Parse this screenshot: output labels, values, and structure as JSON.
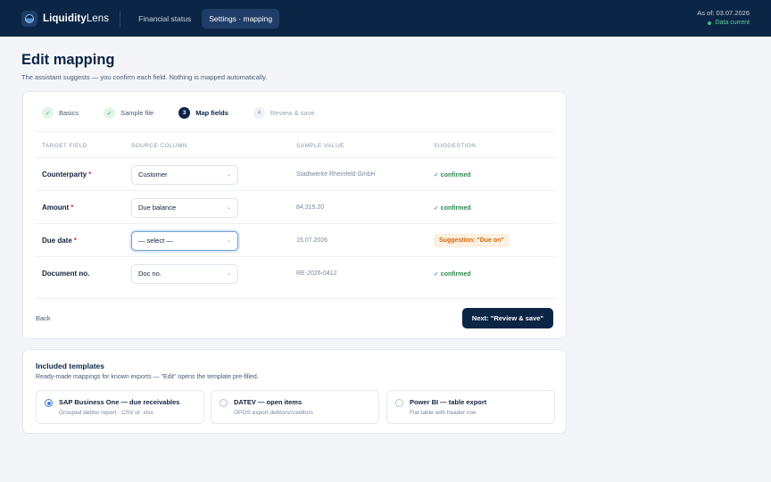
{
  "app": {
    "name_bold": "Liquidity",
    "name_rest": "Lens"
  },
  "nav": [
    {
      "label": "Financial status"
    },
    {
      "label": "Settings · mapping"
    }
  ],
  "status": {
    "as_of": "As of: 03.07.2026",
    "data_state": "Data current",
    "ok_color": "#3fbf7f"
  },
  "page": {
    "title": "Edit mapping",
    "subtitle": "The assistant suggests — you confirm each field. Nothing is mapped automatically."
  },
  "steps": [
    {
      "badge": "✓",
      "label": "Basics",
      "state": "done"
    },
    {
      "badge": "✓",
      "label": "Sample file",
      "state": "done"
    },
    {
      "badge": "3",
      "label": "Map fields",
      "state": "current"
    },
    {
      "badge": "4",
      "label": "Review & save",
      "state": "todo"
    }
  ],
  "table": {
    "headers": {
      "target": "TARGET FIELD",
      "source": "SOURCE COLUMN",
      "sample": "SAMPLE VALUE",
      "suggestion": "SUGGESTION"
    },
    "rows": [
      {
        "field": "Counterparty",
        "required": "*",
        "source": "Customer",
        "sample": "Stadtwerke Rheinfeld GmbH",
        "suggestion": "✓ confirmed"
      },
      {
        "field": "Amount",
        "required": "*",
        "source": "Due balance",
        "sample": "84,315.20",
        "suggestion": "✓ confirmed"
      },
      {
        "field": "Due date",
        "required": "*",
        "source": "— select —",
        "sample": "15.07.2026",
        "suggestion": "Suggestion: \"Due on\""
      },
      {
        "field": "Document no.",
        "required": "",
        "source": "Doc no.",
        "sample": "RE-2026-0412",
        "suggestion": "✓ confirmed"
      }
    ]
  },
  "actions": {
    "back": "Back",
    "next": "Next: \"Review & save\""
  },
  "templates": {
    "title": "Included templates",
    "subtitle": "Ready-made mappings for known exports — \"Edit\" opens the template pre-filled.",
    "items": [
      {
        "name": "SAP Business One — due receivables",
        "desc": "Grouped debtor report · CSV or .xlsx",
        "selected": true
      },
      {
        "name": "DATEV — open items",
        "desc": "OPOS export debtors/creditors",
        "selected": false
      },
      {
        "name": "Power BI — table export",
        "desc": "Flat table with header row",
        "selected": false
      }
    ]
  },
  "colors": {
    "navy": "#0b2546",
    "confirmed": "#2a8a4f",
    "suggestion_bg": "#fdf0e0",
    "suggestion_text": "#cf6a12",
    "required": "#d2334a"
  }
}
